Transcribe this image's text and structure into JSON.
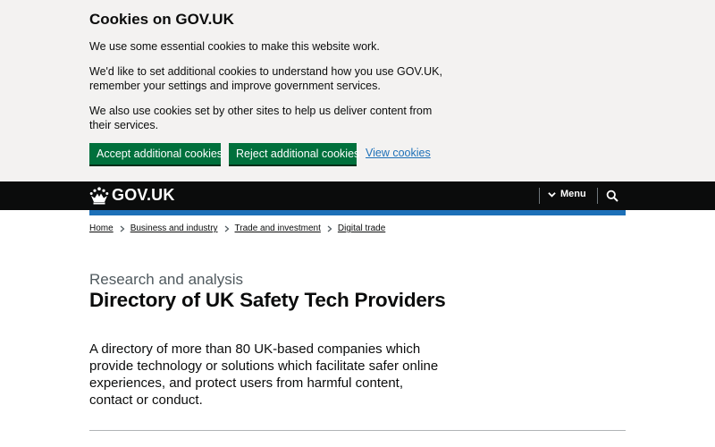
{
  "cookie_banner": {
    "title": "Cookies on GOV.UK",
    "paragraph_1": "We use some essential cookies to make this website work.",
    "paragraph_2": "We'd like to set additional cookies to understand how you use GOV.UK, remember your settings and improve government services.",
    "paragraph_3": "We also use cookies set by other sites to help us deliver content from their services.",
    "accept_label": "Accept additional cookies",
    "reject_label": "Reject additional cookies",
    "view_label": "View cookies"
  },
  "header": {
    "logo_text": "GOV.UK",
    "menu_label": "Menu"
  },
  "breadcrumbs": [
    "Home",
    "Business and industry",
    "Trade and investment",
    "Digital trade"
  ],
  "main": {
    "caption": "Research and analysis",
    "title": "Directory of UK Safety Tech Providers",
    "lead": "A directory of more than 80 UK-based companies which provide technology or solutions which facilitate safer online experiences, and protect users from harmful content, contact or conduct."
  },
  "colors": {
    "banner_bg": "#f3f2f1",
    "button_green": "#00703c",
    "link_blue": "#1d70b8",
    "header_black": "#0b0c0c",
    "header_stripe": "#1d70b8"
  },
  "icons": [
    "crown-icon",
    "chevron-down-icon",
    "search-icon",
    "chevron-right-icon"
  ]
}
